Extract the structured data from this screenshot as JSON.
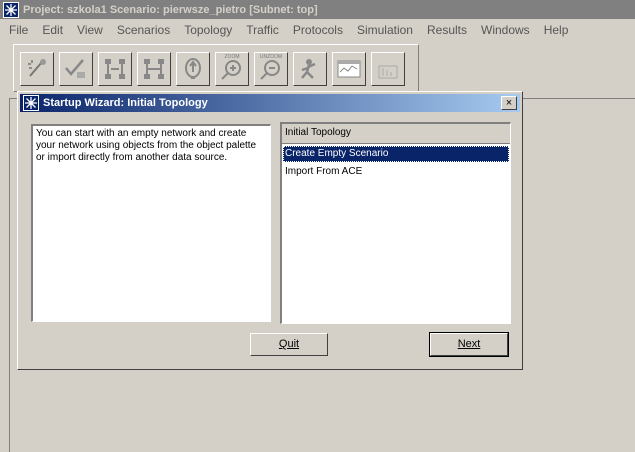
{
  "window": {
    "title": "Project: szkola1 Scenario: pierwsze_pietro  [Subnet: top]",
    "icon": "opnet-star-icon"
  },
  "menu": {
    "items": [
      "File",
      "Edit",
      "View",
      "Scenarios",
      "Topology",
      "Traffic",
      "Protocols",
      "Simulation",
      "Results",
      "Windows",
      "Help"
    ]
  },
  "toolbar": {
    "zoom_caption": "ZOOM",
    "unzoom_caption": "UNZOOM",
    "buttons": [
      "open-palette-icon",
      "check-links-icon",
      "fail-node-icon",
      "recover-node-icon",
      "return-parent-icon",
      "zoom-icon",
      "unzoom-icon",
      "configure-run-icon",
      "view-results-icon",
      "hide-graphs-icon"
    ]
  },
  "dialog": {
    "title": "Startup Wizard: Initial Topology",
    "close": "×",
    "description": "You can start with an empty network and create your network using objects from the object palette or import directly from another data source.",
    "list_header": "Initial Topology",
    "options": [
      "Create Empty Scenario",
      "Import From ACE"
    ],
    "selected_index": 0,
    "quit_label": "Quit",
    "next_label": "Next"
  },
  "colors": {
    "title_active": "#0a246a",
    "title_gradient_end": "#a6caf0",
    "title_inactive": "#808080",
    "face": "#d4d0c8"
  }
}
